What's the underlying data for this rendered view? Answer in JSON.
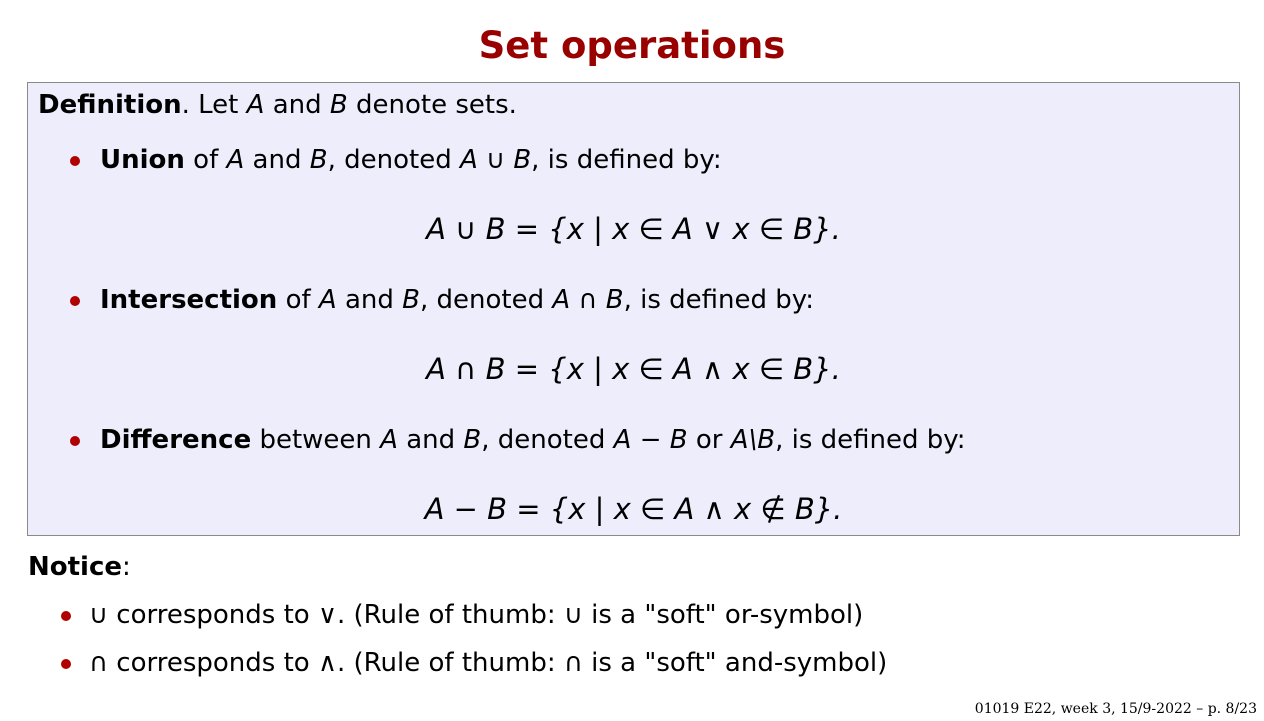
{
  "title": "Set operations",
  "definition": {
    "label": "Definition",
    "intro_rest": ". Let ",
    "var_a": "A",
    "and": " and ",
    "var_b": "B",
    "intro_tail": " denote sets.",
    "items": [
      {
        "term": "Union",
        "pre": " of ",
        "mid": " and ",
        "denoted": ", denoted ",
        "notation": "A ∪ B",
        "post": ", is defined by:",
        "formula": "A ∪ B = {x | x ∈ A ∨ x ∈ B}."
      },
      {
        "term": "Intersection",
        "pre": " of ",
        "mid": " and ",
        "denoted": ", denoted ",
        "notation": "A ∩ B",
        "post": ", is defined by:",
        "formula": "A ∩ B = {x | x ∈ A ∧ x ∈ B}."
      },
      {
        "term": "Difference",
        "pre": " between ",
        "mid": " and ",
        "denoted": ", denoted ",
        "notation": "A − B",
        "or": " or ",
        "notation2": "A\\B",
        "post": ", is defined by:",
        "formula": "A − B = {x | x ∈ A ∧ x ∉ B}."
      }
    ]
  },
  "notice": {
    "label": "Notice",
    "colon": ":",
    "items": [
      "∪ corresponds to ∨. (Rule of thumb: ∪ is a \"soft\" or-symbol)",
      "∩ corresponds to ∧. (Rule of thumb: ∩ is a \"soft\" and-symbol)"
    ]
  },
  "footer": "01019 E22, week 3, 15/9-2022 – p. 8/23",
  "colors": {
    "title": "#990000",
    "bullet": "#b00000",
    "box_background": "#eeedfb",
    "box_border": "#8a8a8a"
  }
}
